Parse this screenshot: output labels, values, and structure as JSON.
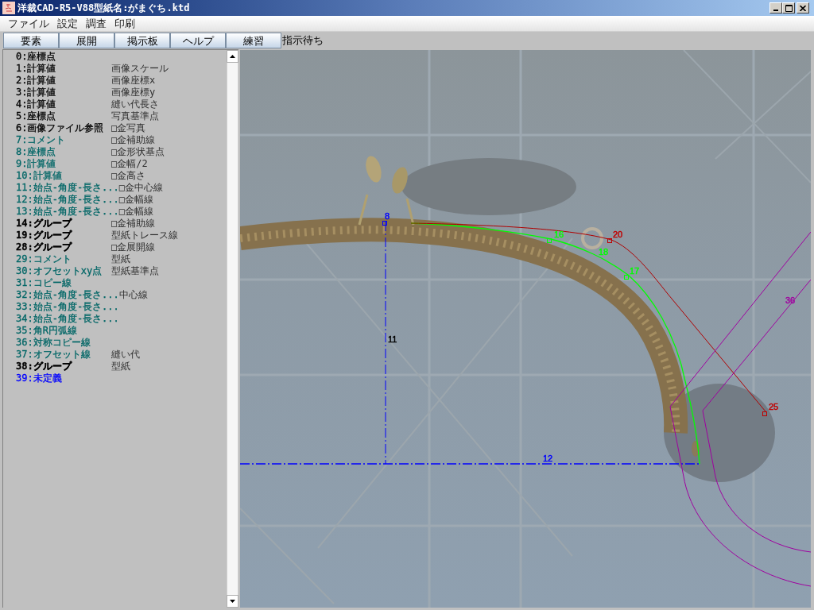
{
  "window": {
    "title": "洋裁CAD-R5-V88型紙名:がまぐち.ktd"
  },
  "menu": [
    "ファイル",
    "設定",
    "調査",
    "印刷"
  ],
  "toolbar": {
    "buttons": [
      "要素",
      "展開",
      "掲示板",
      "ヘルプ",
      "練習"
    ],
    "status": "指示待ち"
  },
  "list": {
    "items": [
      {
        "label": "0:座標点",
        "color": "#000000",
        "kind": "element"
      },
      {
        "label": "1:計算値",
        "note": "画像スケール",
        "color": "#000000",
        "kind": "element"
      },
      {
        "label": "2:計算値",
        "note": "画像座標x",
        "color": "#000000",
        "kind": "element"
      },
      {
        "label": "3:計算値",
        "note": "画像座標y",
        "color": "#000000",
        "kind": "element"
      },
      {
        "label": "4:計算値",
        "note": "縫い代長さ",
        "color": "#000000",
        "kind": "element"
      },
      {
        "label": "5:座標点",
        "note": "写真基準点",
        "color": "#000000",
        "kind": "element"
      },
      {
        "label": "6:画像ファイル参照",
        "note": "□金写真",
        "color": "#000000",
        "kind": "element"
      },
      {
        "label": "7:コメント",
        "note": "□金補助線",
        "color": "#006666",
        "kind": "element"
      },
      {
        "label": "8:座標点",
        "note": "□金形状基点",
        "color": "#006666",
        "kind": "element"
      },
      {
        "label": "9:計算値",
        "note": "□金幅/2",
        "color": "#006666",
        "kind": "element"
      },
      {
        "label": "10:計算値",
        "note": "□金高さ",
        "color": "#006666",
        "kind": "element"
      },
      {
        "label": "11:始点-角度-長さ...",
        "note": "□金中心線",
        "color": "#006666",
        "kind": "element"
      },
      {
        "label": "12:始点-角度-長さ...",
        "note": "□金幅線",
        "color": "#006666",
        "kind": "element"
      },
      {
        "label": "13:始点-角度-長さ...",
        "note": "□金幅線",
        "color": "#006666",
        "kind": "element"
      },
      {
        "label": "14:グループ",
        "note": "□金補助線",
        "color": "#000000",
        "kind": "group"
      },
      {
        "label": "19:グループ",
        "note": "型紙トレース線",
        "color": "#000000",
        "kind": "group"
      },
      {
        "label": "28:グループ",
        "note": "□金展開線",
        "color": "#000000",
        "kind": "group"
      },
      {
        "label": "29:コメント",
        "note": "型紙",
        "color": "#006666",
        "kind": "element"
      },
      {
        "label": "30:オフセットxy点",
        "note": "型紙基準点",
        "color": "#006666",
        "kind": "element"
      },
      {
        "label": "31:コピー線",
        "color": "#006666",
        "kind": "element"
      },
      {
        "label": "32:始点-角度-長さ...",
        "note": "中心線",
        "color": "#006666",
        "kind": "element"
      },
      {
        "label": "33:始点-角度-長さ...",
        "color": "#006666",
        "kind": "element"
      },
      {
        "label": "34:始点-角度-長さ...",
        "color": "#006666",
        "kind": "element"
      },
      {
        "label": "35:角R円弧線",
        "color": "#006666",
        "kind": "element"
      },
      {
        "label": "36:対称コピー線",
        "color": "#006666",
        "kind": "element"
      },
      {
        "label": "37:オフセット線",
        "note": "縫い代",
        "color": "#006666",
        "kind": "element"
      },
      {
        "label": "38:グループ",
        "note": "型紙",
        "color": "#000000",
        "kind": "group"
      },
      {
        "label": "39:未定義",
        "color": "#0000ff",
        "kind": "element"
      }
    ]
  },
  "canvas": {
    "marks": [
      {
        "label": "8",
        "color": "#0000ff",
        "kind": "point"
      },
      {
        "label": "16",
        "color": "#00ff00",
        "kind": "point"
      },
      {
        "label": "20",
        "color": "#c00000",
        "kind": "point"
      },
      {
        "label": "18",
        "color": "#00ff00",
        "kind": "label"
      },
      {
        "label": "17",
        "color": "#00ff00",
        "kind": "point"
      },
      {
        "label": "36",
        "color": "#a000a0",
        "kind": "label"
      },
      {
        "label": "11",
        "color": "#000000",
        "kind": "label"
      },
      {
        "label": "25",
        "color": "#c00000",
        "kind": "point"
      },
      {
        "label": "12",
        "color": "#0000ff",
        "kind": "label"
      }
    ]
  }
}
